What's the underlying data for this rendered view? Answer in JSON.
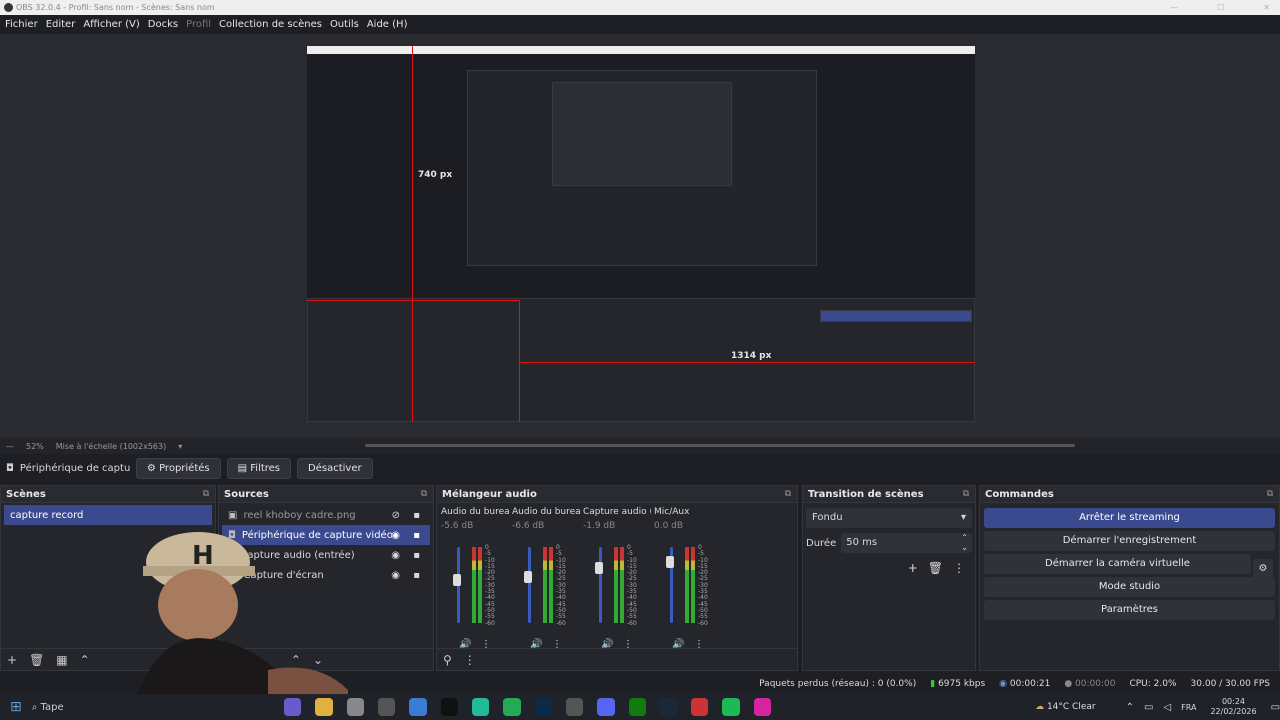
{
  "window": {
    "title": "OBS 32.0.4 - Profil: Sans nom - Scènes: Sans nom"
  },
  "menu": [
    {
      "label": "Fichier",
      "dim": false
    },
    {
      "label": "Editer",
      "dim": false
    },
    {
      "label": "Afficher (V)",
      "dim": false
    },
    {
      "label": "Docks",
      "dim": false
    },
    {
      "label": "Profil",
      "dim": true
    },
    {
      "label": "Collection de scènes",
      "dim": false
    },
    {
      "label": "Outils",
      "dim": false
    },
    {
      "label": "Aide (H)",
      "dim": false
    }
  ],
  "preview": {
    "label_height": "740 px",
    "label_width": "1314 px"
  },
  "zoom": {
    "percent": "52%",
    "mode": "Mise à l'échelle (1002x563)"
  },
  "source_toolbar": {
    "source_name": "Périphérique de capture vid",
    "properties": "Propriétés",
    "filters": "Filtres",
    "deactivate": "Désactiver"
  },
  "scenes": {
    "title": "Scènes",
    "items": [
      "capture record"
    ]
  },
  "sources": {
    "title": "Sources",
    "items": [
      {
        "label": "reel khoboy cadre.png",
        "icon": "image-icon"
      },
      {
        "label": "Périphérique de capture vidéo",
        "icon": "camera-icon"
      },
      {
        "label": "Capture audio (entrée)",
        "icon": "mic-icon"
      },
      {
        "label": "Capture d'écran",
        "icon": "monitor-icon"
      }
    ]
  },
  "mixer": {
    "title": "Mélangeur audio",
    "channels": [
      {
        "name": "Audio du bureau",
        "db": "-5.6 dB",
        "level": 0.55
      },
      {
        "name": "Audio du bureau 2",
        "db": "-6.6 dB",
        "level": 0.6
      },
      {
        "name": "Capture audio (ent",
        "db": "-1.9 dB",
        "level": 0.75
      },
      {
        "name": "Mic/Aux",
        "db": "0.0 dB",
        "level": 0.85
      }
    ],
    "scale": [
      "0",
      "-5",
      "-10",
      "-15",
      "-20",
      "-25",
      "-30",
      "-35",
      "-40",
      "-45",
      "-50",
      "-55",
      "-60"
    ]
  },
  "transitions": {
    "title": "Transition de scènes",
    "type": "Fondu",
    "duration_label": "Durée",
    "duration": "50 ms"
  },
  "commands": {
    "title": "Commandes",
    "buttons": [
      "Arrêter le streaming",
      "Démarrer l'enregistrement",
      "Démarrer la caméra virtuelle",
      "Mode studio",
      "Paramètres"
    ]
  },
  "status": {
    "dropped": "Paquets perdus (réseau) : 0 (0.0%)",
    "bitrate": "6975 kbps",
    "stream_time": "00:00:21",
    "rec_time": "00:00:00",
    "cpu": "CPU: 2.0%",
    "fps": "30.00 / 30.00 FPS"
  },
  "taskbar": {
    "search": "Tape",
    "weather": "14°C  Clear",
    "lang": "FRA",
    "time": "00:24",
    "date": "22/02/2026"
  },
  "colors": {
    "accent": "#3b4a8f",
    "bg": "#1e1f24",
    "red_guide": "#dd1111"
  }
}
